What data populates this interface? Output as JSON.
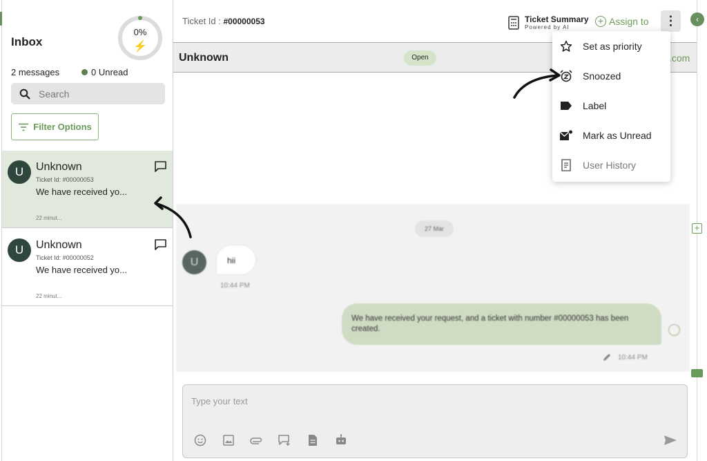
{
  "sidebar": {
    "title": "Inbox",
    "progress": {
      "percent_label": "0%",
      "value": 0
    },
    "message_count": "2 messages",
    "unread_label": "0 Unread",
    "search_placeholder": "Search",
    "filter_label": "Filter Options",
    "conversations": [
      {
        "avatar": "U",
        "name": "Unknown",
        "ticket": "Ticket Id: #00000053",
        "preview": "We have received yo...",
        "time": "22 minut..."
      },
      {
        "avatar": "U",
        "name": "Unknown",
        "ticket": "Ticket Id: #00000052",
        "preview": "We have received yo...",
        "time": "22 minut..."
      }
    ]
  },
  "topbar": {
    "ticket_label": "Ticket Id : ",
    "ticket_value": "#00000053",
    "summary_title": "Ticket Summary",
    "summary_sub": "Powered by AI",
    "assign_label": "Assign to",
    "more_icon": "⋮"
  },
  "conversation": {
    "name": "Unknown",
    "status": "Open",
    "domain_tail": ".com"
  },
  "chat": {
    "date": "27 Mar",
    "incoming": {
      "avatar": "U",
      "text": "hii",
      "time": "10:44 PM"
    },
    "outgoing": {
      "text": "We have received your request, and a ticket with number #00000053 has been created.",
      "time": "10:44 PM"
    }
  },
  "composer": {
    "placeholder": "Type your text"
  },
  "menu": {
    "items": [
      {
        "label": "Set as priority",
        "icon": "star-icon"
      },
      {
        "label": "Snoozed",
        "icon": "alarm-snooze-icon"
      },
      {
        "label": "Label",
        "icon": "label-icon"
      },
      {
        "label": "Mark as Unread",
        "icon": "mark-unread-icon"
      },
      {
        "label": "User History",
        "icon": "history-icon"
      }
    ]
  },
  "colors": {
    "accent": "#6a9a5a",
    "active_row": "#e1e9dc",
    "avatar": "#2f463d"
  }
}
